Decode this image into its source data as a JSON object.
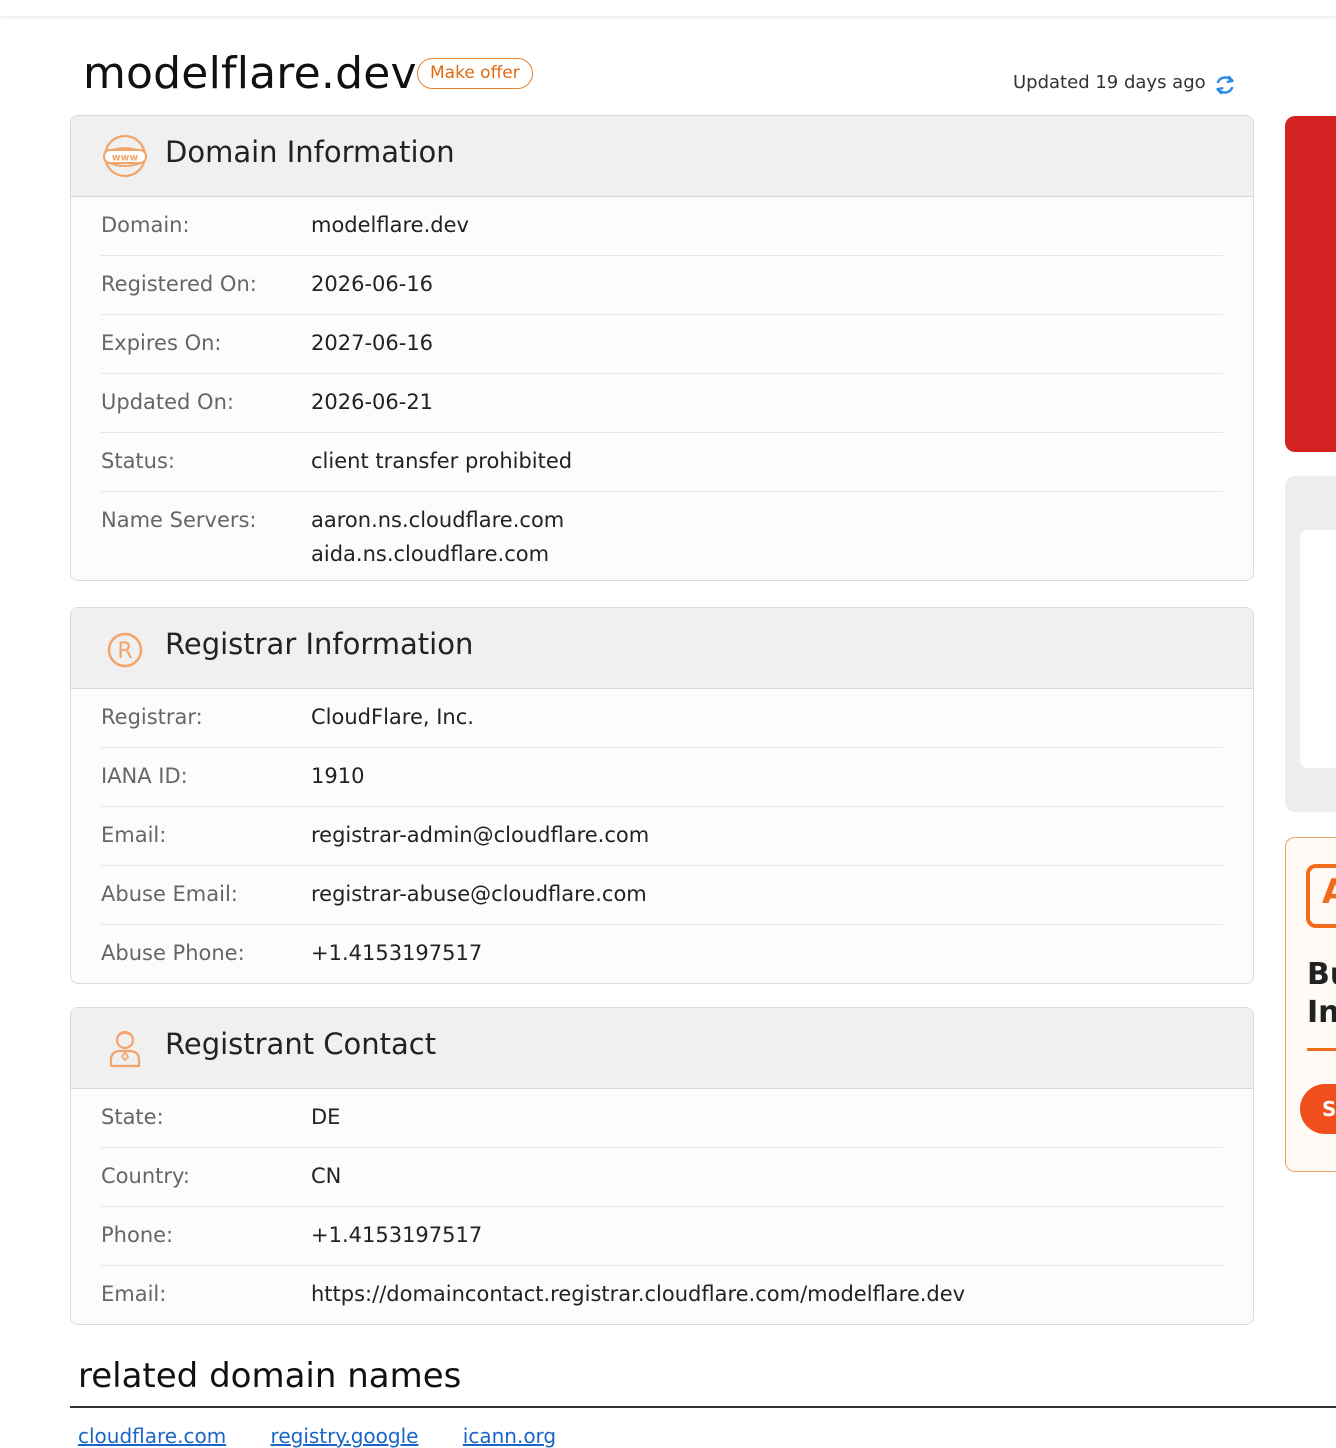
{
  "header": {
    "domain": "modelflare.dev",
    "offer_label": "Make offer",
    "updated_text": "Updated 19 days ago"
  },
  "domain_info": {
    "title": "Domain Information",
    "icon": "www-icon",
    "rows": [
      {
        "label": "Domain:",
        "value": "modelflare.dev"
      },
      {
        "label": "Registered On:",
        "value": "2026-06-16"
      },
      {
        "label": "Expires On:",
        "value": "2027-06-16"
      },
      {
        "label": "Updated On:",
        "value": "2026-06-21"
      },
      {
        "label": "Status:",
        "value": "client transfer prohibited"
      },
      {
        "label": "Name Servers:",
        "value": "aaron.ns.cloudflare.com",
        "value2": "aida.ns.cloudflare.com"
      }
    ]
  },
  "registrar_info": {
    "title": "Registrar Information",
    "icon": "registered-icon",
    "rows": [
      {
        "label": "Registrar:",
        "value": "CloudFlare, Inc."
      },
      {
        "label": "IANA ID:",
        "value": "1910"
      },
      {
        "label": "Email:",
        "value": "registrar-admin@cloudflare.com"
      },
      {
        "label": "Abuse Email:",
        "value": "registrar-abuse@cloudflare.com"
      },
      {
        "label": "Abuse Phone:",
        "value": "+1.4153197517"
      }
    ]
  },
  "registrant_contact": {
    "title": "Registrant Contact",
    "icon": "person-icon",
    "rows": [
      {
        "label": "State:",
        "value": "DE"
      },
      {
        "label": "Country:",
        "value": "CN"
      },
      {
        "label": "Phone:",
        "value": "+1.4153197517"
      },
      {
        "label": "Email:",
        "value": "https://domaincontact.registrar.cloudflare.com/modelflare.dev"
      }
    ]
  },
  "related": {
    "title": "related domain names",
    "links": [
      "cloudflare.com",
      "registry.google",
      "icann.org"
    ]
  },
  "side_ads": {
    "promo_letter": "A",
    "promo_text_1": "Bu",
    "promo_text_2": "In",
    "promo_button": "S"
  },
  "colors": {
    "accent_orange": "#e8802a",
    "link_blue": "#1a66c8",
    "ad_red": "#d42222"
  }
}
